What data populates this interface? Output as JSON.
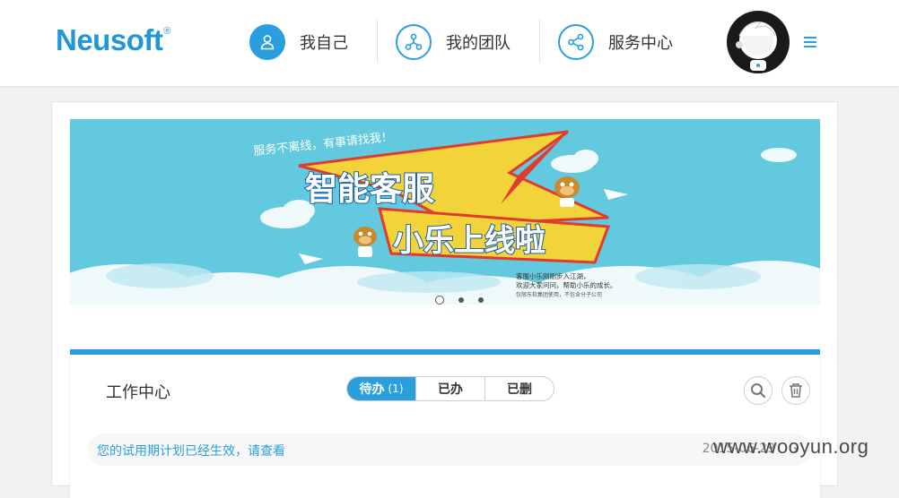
{
  "header": {
    "logo": "Neusoft",
    "logo_mark": "®",
    "nav": [
      {
        "label": "我自己",
        "icon": "user-icon"
      },
      {
        "label": "我的团队",
        "icon": "team-icon"
      },
      {
        "label": "服务中心",
        "icon": "share-icon"
      }
    ],
    "avatar_icon": "robot-avatar",
    "menu_icon": "hamburger-icon"
  },
  "banner": {
    "slogan": "服务不离线，有事请找我！",
    "headline_1": "智能客服",
    "headline_2": "小乐上线啦",
    "desc_1": "客服小乐刚刚步入江湖，",
    "desc_2": "欢迎大家问问，帮助小乐的成长。",
    "desc_3": "仅限东软集团使用，不包含分子公司",
    "slides": 3,
    "active_slide": 1
  },
  "work_center": {
    "title": "工作中心",
    "tabs": [
      {
        "label": "待办",
        "count": "(1)"
      },
      {
        "label": "已办"
      },
      {
        "label": "已删"
      }
    ],
    "search_icon": "search-icon",
    "delete_icon": "trash-icon",
    "messages": [
      {
        "text": "您的试用期计划已经生效，请查看",
        "date": "2015-06-29",
        "arrow": "›"
      }
    ]
  },
  "watermark": "www.wooyun.org",
  "colors": {
    "accent": "#2b9fdc",
    "banner_bg": "#63c9df"
  }
}
